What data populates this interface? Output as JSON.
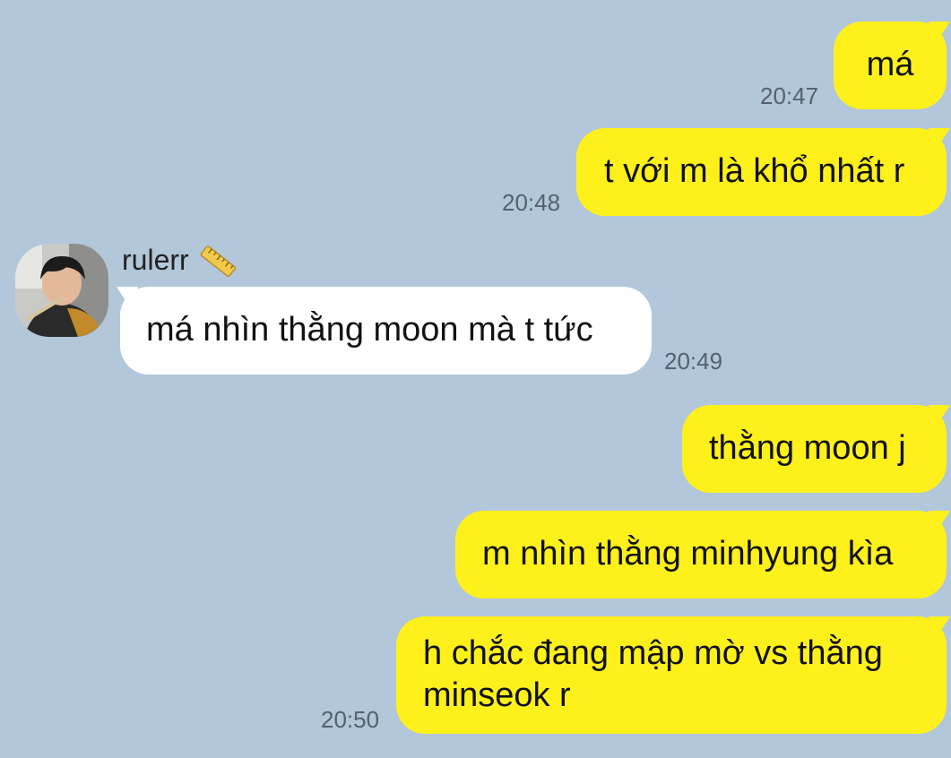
{
  "conversation": {
    "messages": [
      {
        "direction": "out",
        "text": "má",
        "time": "20:47"
      },
      {
        "direction": "out",
        "text": "t với m là khổ nhất r",
        "time": "20:48"
      },
      {
        "direction": "in",
        "sender": "rulerr",
        "text": "má nhìn thằng moon mà t tức",
        "time": "20:49"
      },
      {
        "direction": "out",
        "text": "thằng moon j",
        "time": ""
      },
      {
        "direction": "out",
        "text": "m nhìn thằng minhyung kìa",
        "time": ""
      },
      {
        "direction": "out",
        "text": "h chắc đang mập mờ vs thằng minseok r",
        "time": "20:50"
      }
    ],
    "sender": {
      "name": "rulerr",
      "name_icon": "ruler-icon",
      "avatar_icon": "avatar-photo"
    }
  },
  "colors": {
    "background": "#b2c7da",
    "outgoing_bubble": "#fef01b",
    "incoming_bubble": "#ffffff",
    "timestamp": "#556170"
  }
}
